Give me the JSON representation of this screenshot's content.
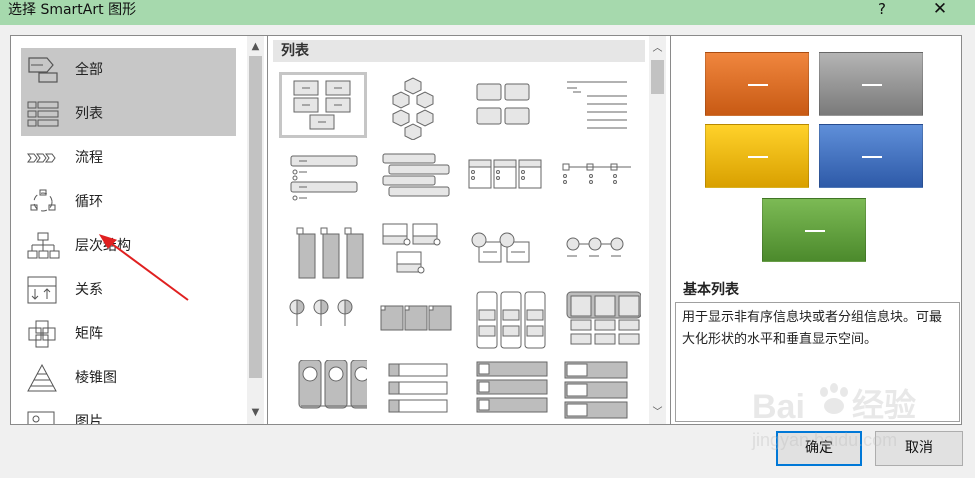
{
  "window": {
    "title": "选择 SmartArt 图形",
    "help_label": "?",
    "close_label": "✕"
  },
  "categories": [
    {
      "label": "全部",
      "icon": "all-icon",
      "selected": true
    },
    {
      "label": "列表",
      "icon": "list-icon",
      "selected": true
    },
    {
      "label": "流程",
      "icon": "process-icon",
      "selected": false
    },
    {
      "label": "循环",
      "icon": "cycle-icon",
      "selected": false
    },
    {
      "label": "层次结构",
      "icon": "hierarchy-icon",
      "selected": false
    },
    {
      "label": "关系",
      "icon": "relationship-icon",
      "selected": false
    },
    {
      "label": "矩阵",
      "icon": "matrix-icon",
      "selected": false
    },
    {
      "label": "棱锥图",
      "icon": "pyramid-icon",
      "selected": false
    },
    {
      "label": "图片",
      "icon": "picture-icon",
      "selected": false
    }
  ],
  "gallery": {
    "section_title": "列表",
    "selected_index": 0
  },
  "preview": {
    "name": "基本列表",
    "description": "用于显示非有序信息块或者分组信息块。可最大化形状的水平和垂直显示空间。",
    "colors": {
      "orange": "#e0712a",
      "gray": "#9a9a9a",
      "yellow": "#f2b800",
      "blue": "#4472c4",
      "green": "#5fa03c"
    }
  },
  "buttons": {
    "ok": "确定",
    "cancel": "取消"
  },
  "watermark": {
    "text": "Baidu经验",
    "url_text": "jingyan.baidu.com"
  },
  "annotation": {
    "arrow_color": "#e02020"
  }
}
